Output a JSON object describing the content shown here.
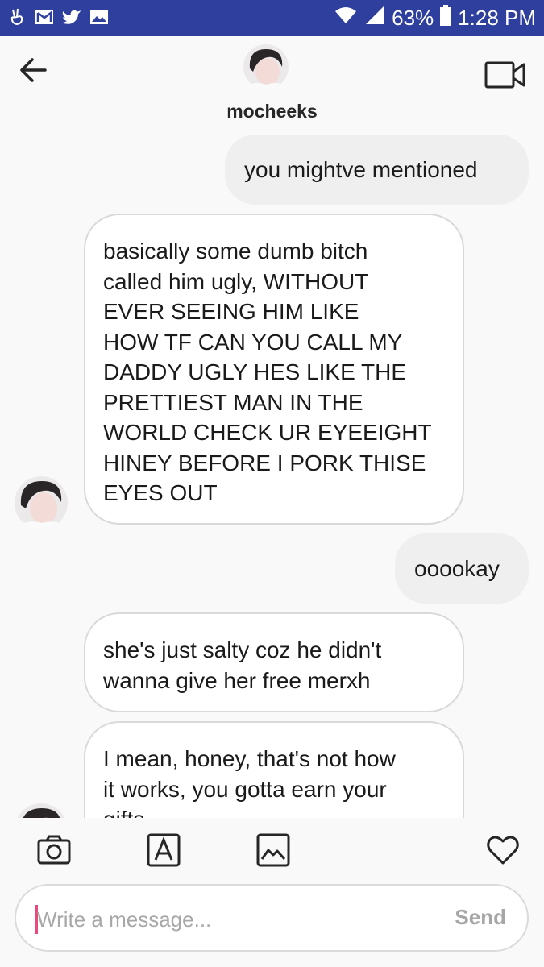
{
  "status_bar": {
    "battery": "63%",
    "time": "1:28 PM",
    "left_icons": [
      "hand-v-icon",
      "mail-icon",
      "twitter-icon",
      "image-icon"
    ],
    "right_icons": [
      "wifi-icon",
      "signal-icon",
      "battery-icon"
    ]
  },
  "header": {
    "username": "mocheeks",
    "back_icon": "arrow-left-icon",
    "video_icon": "video-camera-icon"
  },
  "messages": [
    {
      "direction": "outgoing",
      "text": "you mightve mentioned"
    },
    {
      "direction": "incoming",
      "text": "basically some dumb bitch\ncalled him ugly, WITHOUT\nEVER SEEING HIM LIKE\nHOW TF CAN YOU CALL MY\nDADDY UGLY HES LIKE THE\nPRETTIEST MAN IN THE\nWORLD CHECK UR EYEEIGHT\nHINEY BEFORE I PORK THISE\nEYES OUT"
    },
    {
      "direction": "outgoing",
      "text": "ooookay"
    },
    {
      "direction": "incoming",
      "text": "she's just salty coz he didn't\nwanna give her free merxh"
    },
    {
      "direction": "incoming",
      "text": "I mean, honey, that's not how\nit works, you gotta earn your\ngifts"
    }
  ],
  "composer": {
    "placeholder": "Write a message...",
    "send_label": "Send",
    "toolbar_icons": [
      "camera-icon",
      "sticker-a-icon",
      "gallery-icon",
      "heart-icon"
    ]
  },
  "colors": {
    "status_bar_bg": "#2f3f9e",
    "outgoing_bubble": "#efefef",
    "incoming_bubble": "#ffffff",
    "caret": "#e94a7a"
  }
}
